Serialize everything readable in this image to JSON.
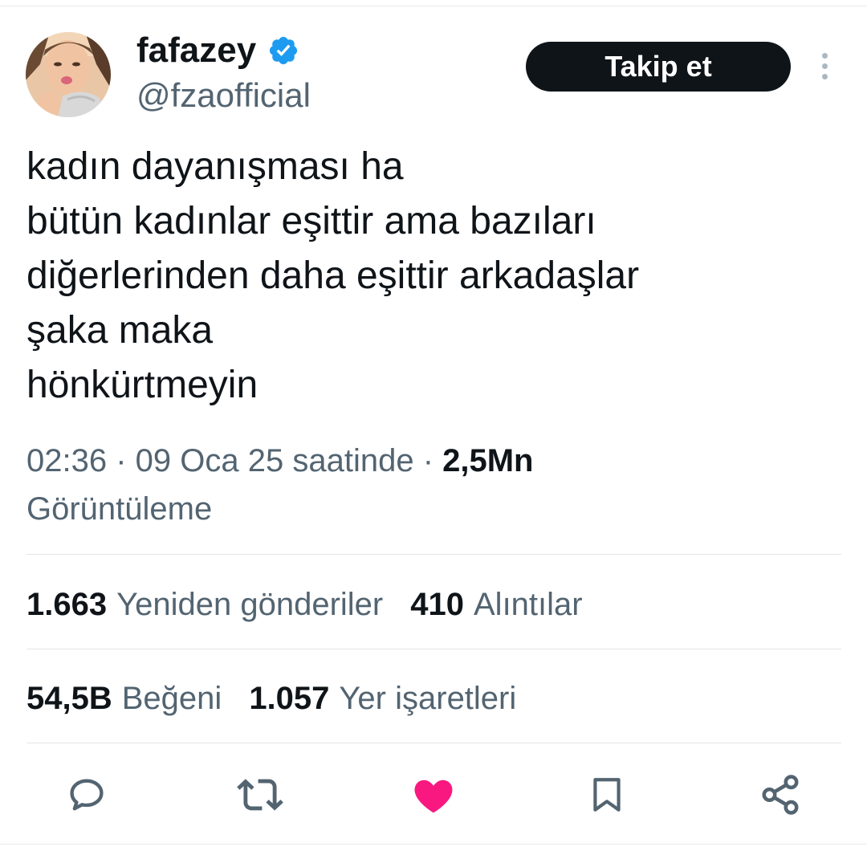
{
  "user": {
    "display_name": "fafazey",
    "handle": "@fzaofficial",
    "verified": true,
    "verified_color": "#1d9bf0",
    "avatar_icon": "profile-photo"
  },
  "follow_label": "Takip et",
  "tweet_lines": [
    "kadın dayanışması ha",
    "bütün kadınlar eşittir ama bazıları",
    "diğerlerinden daha eşittir arkadaşlar",
    "şaka maka",
    "hönkürtmeyin"
  ],
  "meta": {
    "time": "02:36",
    "separator": " · ",
    "date": "09 Oca 25 saatinde",
    "views": "2,5Mn",
    "views_label": "Görüntüleme"
  },
  "stats": {
    "retweets": {
      "count": "1.663",
      "label": "Yeniden gönderiler"
    },
    "quotes": {
      "count": "410",
      "label": "Alıntılar"
    },
    "likes": {
      "count": "54,5B",
      "label": "Beğeni"
    },
    "bookmarks": {
      "count": "1.057",
      "label": "Yer işaretleri"
    }
  },
  "actions": {
    "reply_icon": "speech-bubble",
    "retweet_icon": "retweet-arrows",
    "like_icon": "heart-filled",
    "bookmark_icon": "bookmark",
    "share_icon": "share-nodes",
    "like_color": "#f91880",
    "icon_color": "#536471"
  }
}
